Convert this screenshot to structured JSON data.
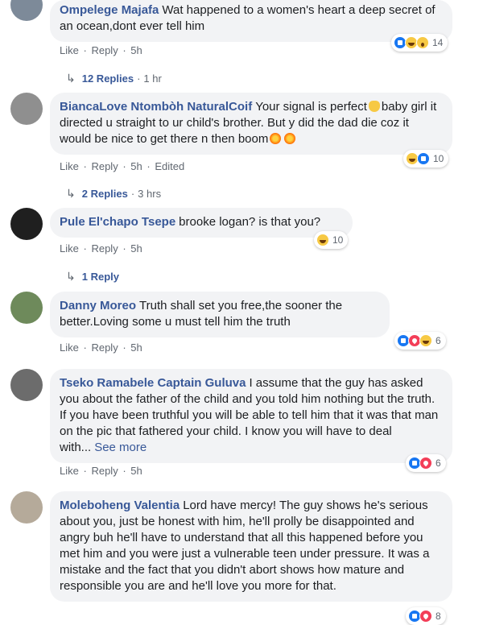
{
  "comments": [
    {
      "author": "Ompelege Majafa",
      "text": "Wat happened to a women's heart a deep secret of an ocean,dont ever tell him",
      "like": "Like",
      "reply": "Reply",
      "time": "5h",
      "reaction_count": "14",
      "replies_label": "12 Replies",
      "replies_time": "1 hr"
    },
    {
      "author": "BiancaLove Ntombòh NaturalCoif",
      "text_part1": "Your signal is perfect",
      "text_part2": "baby girl it directed u straight to ur child's brother. But y did the dad die coz it would be nice to get there n then boom",
      "like": "Like",
      "reply": "Reply",
      "time": "5h",
      "edited": "Edited",
      "reaction_count": "10",
      "replies_label": "2 Replies",
      "replies_time": "3 hrs"
    },
    {
      "author": "Pule El'chapo Tsepe",
      "text": "brooke logan? is that you?",
      "like": "Like",
      "reply": "Reply",
      "time": "5h",
      "reaction_count": "10",
      "replies_label": "1 Reply"
    },
    {
      "author": "Danny Moreo",
      "text": "Truth shall set you free,the sooner the better.Loving some u must tell him the truth",
      "like": "Like",
      "reply": "Reply",
      "time": "5h",
      "reaction_count": "6"
    },
    {
      "author": "Tseko Ramabele Captain Guluva",
      "text": "I assume that the guy has asked you about the father of the child and you told him nothing but the truth. If you have been truthful you will be able to tell him that it was that man on the pic that fathered your child. I know you will have to deal with...",
      "see_more": "See more",
      "like": "Like",
      "reply": "Reply",
      "time": "5h",
      "reaction_count": "6"
    },
    {
      "author": "Moleboheng Valentia",
      "text": "Lord have mercy! The guy shows he's serious about you, just be honest with him, he'll prolly be disappointed and angry buh he'll have to understand that all this happened before you met him and you were just a vulnerable teen under pressure. It was a mistake and the fact that you didn't abort shows how mature and responsible you are and he'll love you more for that.",
      "reaction_count": "8"
    }
  ],
  "separator": "·"
}
